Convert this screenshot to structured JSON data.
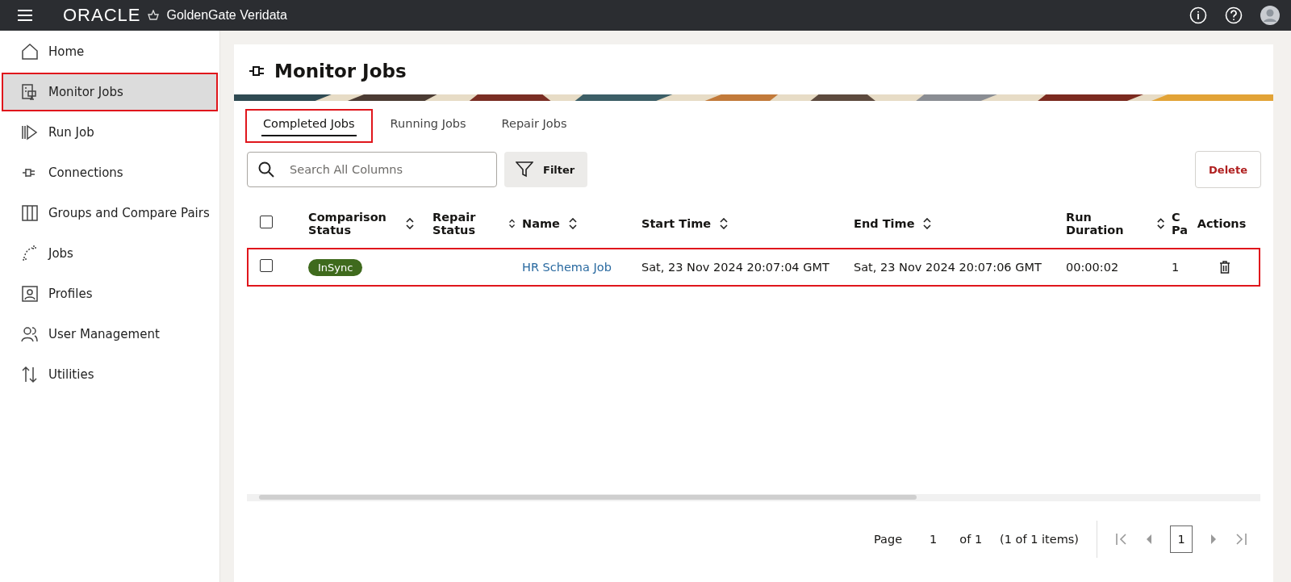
{
  "header": {
    "brand": "ORACLE",
    "product": "GoldenGate Veridata"
  },
  "sidebar": {
    "items": [
      {
        "label": "Home",
        "selected": false,
        "highlighted": false
      },
      {
        "label": "Monitor Jobs",
        "selected": true,
        "highlighted": true
      },
      {
        "label": "Run Job",
        "selected": false,
        "highlighted": false
      },
      {
        "label": "Connections",
        "selected": false,
        "highlighted": false
      },
      {
        "label": "Groups and Compare Pairs",
        "selected": false,
        "highlighted": false
      },
      {
        "label": "Jobs",
        "selected": false,
        "highlighted": false
      },
      {
        "label": "Profiles",
        "selected": false,
        "highlighted": false
      },
      {
        "label": "User Management",
        "selected": false,
        "highlighted": false
      },
      {
        "label": "Utilities",
        "selected": false,
        "highlighted": false
      }
    ]
  },
  "page": {
    "title": "Monitor Jobs"
  },
  "tabs": [
    {
      "label": "Completed Jobs",
      "selected": true,
      "highlighted": true
    },
    {
      "label": "Running Jobs",
      "selected": false,
      "highlighted": false
    },
    {
      "label": "Repair Jobs",
      "selected": false,
      "highlighted": false
    }
  ],
  "search": {
    "placeholder": "Search All Columns"
  },
  "filter_button": "Filter",
  "delete_button": "Delete",
  "table": {
    "select_all_checked": false,
    "columns": [
      {
        "label": "Comparison Status",
        "sortable": true
      },
      {
        "label": "Repair Status",
        "sortable": true
      },
      {
        "label": "Name",
        "sortable": true
      },
      {
        "label": "Start Time",
        "sortable": true
      },
      {
        "label": "End Time",
        "sortable": true
      },
      {
        "label": "Run Duration",
        "sortable": true
      },
      {
        "label": "C Pa",
        "sortable": false
      },
      {
        "label": "Actions",
        "sortable": false
      }
    ],
    "rows": [
      {
        "checked": false,
        "highlighted": true,
        "status": "InSync",
        "name": "HR Schema Job",
        "start": "Sat, 23 Nov 2024 20:07:04 GMT",
        "end": "Sat, 23 Nov 2024 20:07:06 GMT",
        "duration": "00:00:02",
        "column_7": "1"
      }
    ]
  },
  "pagination": {
    "page_label": "Page",
    "page": "1",
    "of": "of 1",
    "items": "(1 of 1 items)",
    "current": "1"
  }
}
